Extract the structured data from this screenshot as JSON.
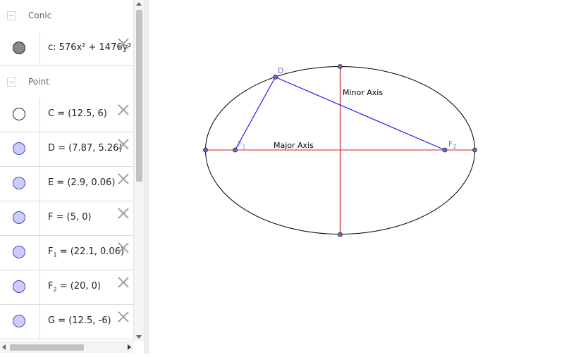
{
  "algebra": {
    "conic_header": "Conic",
    "conic_expr": "c: 576x² + 1476y² -",
    "point_header": "Point",
    "points": [
      {
        "label": "C",
        "sub": "",
        "value": " = (12.5, 6)",
        "fill": "#ffffff"
      },
      {
        "label": "D",
        "sub": "",
        "value": " = (7.87, 5.26)",
        "fill": "#ccccff"
      },
      {
        "label": "E",
        "sub": "",
        "value": " = (2.9, 0.06)",
        "fill": "#ccccff"
      },
      {
        "label": "F",
        "sub": "",
        "value": " = (5, 0)",
        "fill": "#ccccff"
      },
      {
        "label": "F",
        "sub": "1",
        "value": " = (22.1, 0.06)",
        "fill": "#ccccff"
      },
      {
        "label": "F",
        "sub": "2",
        "value": " = (20, 0)",
        "fill": "#ccccff"
      },
      {
        "label": "G",
        "sub": "",
        "value": " = (12.5, -6)",
        "fill": "#ccccff"
      }
    ],
    "conic_fill": "#888888"
  },
  "graphics": {
    "minor_axis_label": "Minor Axis",
    "major_axis_label": "Major Axis",
    "point_d_label": "D",
    "point_f2_label": "F",
    "point_f2_sub": "2",
    "point_f1_label": "F",
    "point_f1_sub": "1",
    "colors": {
      "axis": "#e8474b",
      "segment": "#1a1aff",
      "point": "#6a6acf",
      "ellipse": "#000000"
    }
  }
}
